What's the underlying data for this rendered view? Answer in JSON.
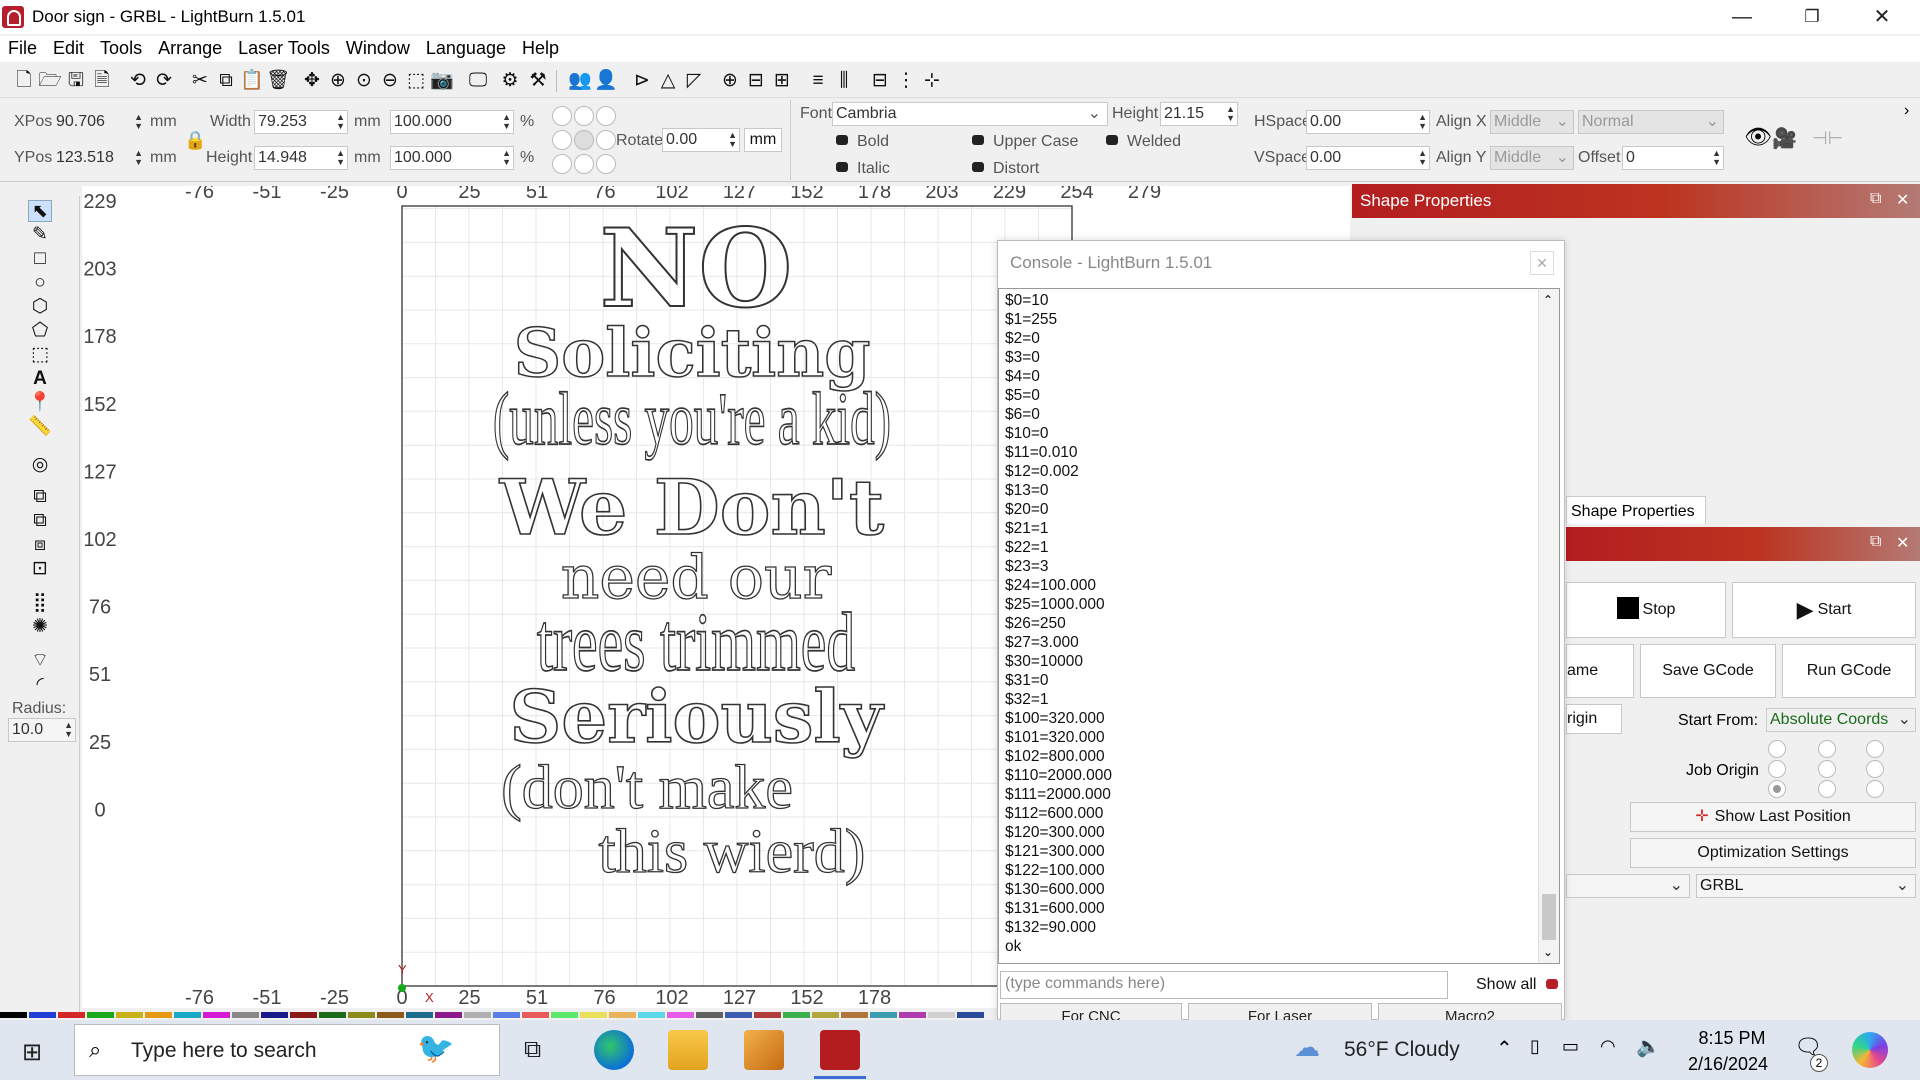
{
  "window": {
    "title": "Door sign - GRBL - LightBurn 1.5.01"
  },
  "menu": [
    "File",
    "Edit",
    "Tools",
    "Arrange",
    "Laser Tools",
    "Window",
    "Language",
    "Help"
  ],
  "props": {
    "xpos_label": "XPos",
    "xpos_value": "90.706",
    "ypos_label": "YPos",
    "ypos_value": "123.518",
    "unit_mm": "mm",
    "width_label": "Width",
    "width_value": "79.253",
    "height_label": "Height",
    "height_value": "14.948",
    "scale_w": "100.000",
    "scale_h": "100.000",
    "pct": "%",
    "rotate_label": "Rotate",
    "rotate_value": "0.00",
    "rotate_unit": "mm"
  },
  "text_props": {
    "font_label": "Font",
    "font_value": "Cambria",
    "height_label": "Height",
    "height_value": "21.15",
    "hspace_label": "HSpace",
    "hspace_value": "0.00",
    "vspace_label": "VSpace",
    "vspace_value": "0.00",
    "alignx_label": "Align X",
    "alignx_value": "Middle",
    "aligny_label": "Align Y",
    "aligny_value": "Middle",
    "mode_value": "Normal",
    "offset_label": "Offset",
    "offset_value": "0",
    "bold": "Bold",
    "italic": "Italic",
    "upper": "Upper Case",
    "distort": "Distort",
    "welded": "Welded"
  },
  "left_tools": {
    "radius_label": "Radius:",
    "radius_value": "10.0"
  },
  "ruler": {
    "top": [
      "-76",
      "-51",
      "-25",
      "0",
      "25",
      "51",
      "76",
      "102",
      "127",
      "152",
      "178",
      "203",
      "229",
      "254",
      "279"
    ],
    "left": [
      "229",
      "203",
      "178",
      "152",
      "127",
      "102",
      "76",
      "51",
      "25",
      "0"
    ],
    "bottom": [
      "-76",
      "-51",
      "-25",
      "0",
      "25",
      "51",
      "76",
      "102",
      "127",
      "152",
      "178"
    ],
    "axis_x": "X",
    "axis_y": "Y"
  },
  "design_text": [
    "NO",
    "Soliciting",
    "(unless you're a kid)",
    "We Don't",
    "need our",
    "trees trimmed",
    "Seriously",
    "(don't make",
    "this wierd)"
  ],
  "console": {
    "title": "Console - LightBurn 1.5.01",
    "lines": [
      "$0=10",
      "$1=255",
      "$2=0",
      "$3=0",
      "$4=0",
      "$5=0",
      "$6=0",
      "$10=0",
      "$11=0.010",
      "$12=0.002",
      "$13=0",
      "$20=0",
      "$21=1",
      "$22=1",
      "$23=3",
      "$24=100.000",
      "$25=1000.000",
      "$26=250",
      "$27=3.000",
      "$30=10000",
      "$31=0",
      "$32=1",
      "$100=320.000",
      "$101=320.000",
      "$102=800.000",
      "$110=2000.000",
      "$111=2000.000",
      "$112=600.000",
      "$120=300.000",
      "$121=300.000",
      "$122=100.000",
      "$130=600.000",
      "$131=600.000",
      "$132=90.000",
      "ok"
    ],
    "input_placeholder": "(type commands here)",
    "show_all": "Show all",
    "tabs": [
      "For CNC",
      "For Laser",
      "Macro2"
    ]
  },
  "shape_panel": {
    "title": "Shape Properties",
    "tab": "Shape Properties"
  },
  "laser_panel": {
    "stop": "Stop",
    "start": "Start",
    "frame": "ame",
    "save_gcode": "Save GCode",
    "run_gcode": "Run GCode",
    "origin": "rigin",
    "start_from_label": "Start From:",
    "start_from_value": "Absolute Coords",
    "job_origin_label": "Job Origin",
    "show_last": "Show Last Position",
    "optimization": "Optimization Settings",
    "device": "GRBL"
  },
  "palette": [
    "#000000",
    "#1f3fd6",
    "#d52727",
    "#18a81b",
    "#c9b319",
    "#e69a14",
    "#1aa8c7",
    "#d61bd6",
    "#888888",
    "#1a1a8c",
    "#8c1a1a",
    "#1a6b1a",
    "#8c8c1a",
    "#8c5a1a",
    "#1a6b8c",
    "#8c1a8c",
    "#b0b0b0",
    "#5b7de8",
    "#e85b5b",
    "#5be86b",
    "#e8e05b",
    "#e8b35b",
    "#5bd7e8",
    "#e85be8",
    "#606060",
    "#3c5cb0",
    "#b03c3c",
    "#3cb04c",
    "#b0a83c",
    "#b0763c",
    "#3c9cb0",
    "#b03cb0",
    "#d0d0d0",
    "#2a4a9a"
  ],
  "taskbar": {
    "search_placeholder": "Type here to search",
    "weather": "56°F  Cloudy",
    "time": "8:15 PM",
    "date": "2/16/2024",
    "notif_count": "2"
  }
}
